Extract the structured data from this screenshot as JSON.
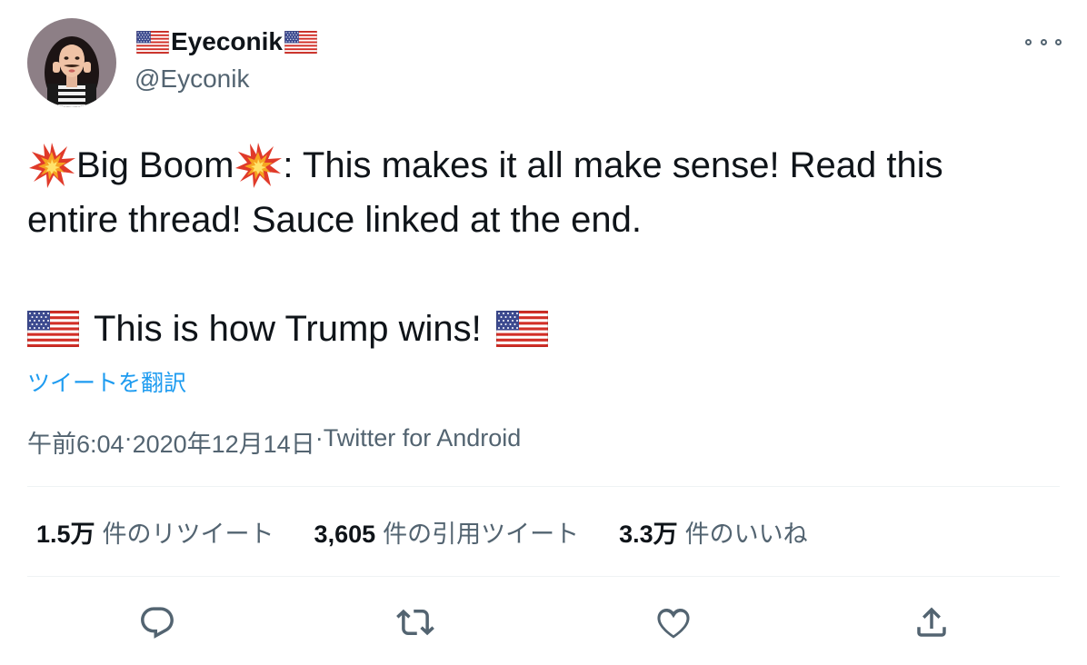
{
  "user": {
    "display_name": "Eyeconik",
    "handle": "@Eyconik"
  },
  "tweet": {
    "line1_a": "Big Boom",
    "line1_b": ": This makes it all make sense! Read this",
    "line2": "entire thread! Sauce linked at the end.",
    "line3": "This is how Trump wins!",
    "translate_label": "ツイートを翻訳"
  },
  "meta": {
    "time": "午前6:04",
    "date": "2020年12月14日",
    "source": "Twitter for Android",
    "separator": " · "
  },
  "stats": {
    "retweets_count": "1.5万",
    "retweets_label": "件のリツイート",
    "quotes_count": "3,605",
    "quotes_label": "件の引用ツイート",
    "likes_count": "3.3万",
    "likes_label": "件のいいね"
  },
  "colors": {
    "accent": "#1d9bf0",
    "secondary_text": "#536471",
    "primary_text": "#0f1419",
    "divider": "#eff3f4"
  },
  "icons": {
    "more": "more-dots-icon",
    "reply": "reply-icon",
    "retweet": "retweet-icon",
    "like": "heart-icon",
    "share": "share-icon",
    "emoji_boom": "collision-emoji-icon",
    "emoji_flag": "us-flag-icon"
  }
}
